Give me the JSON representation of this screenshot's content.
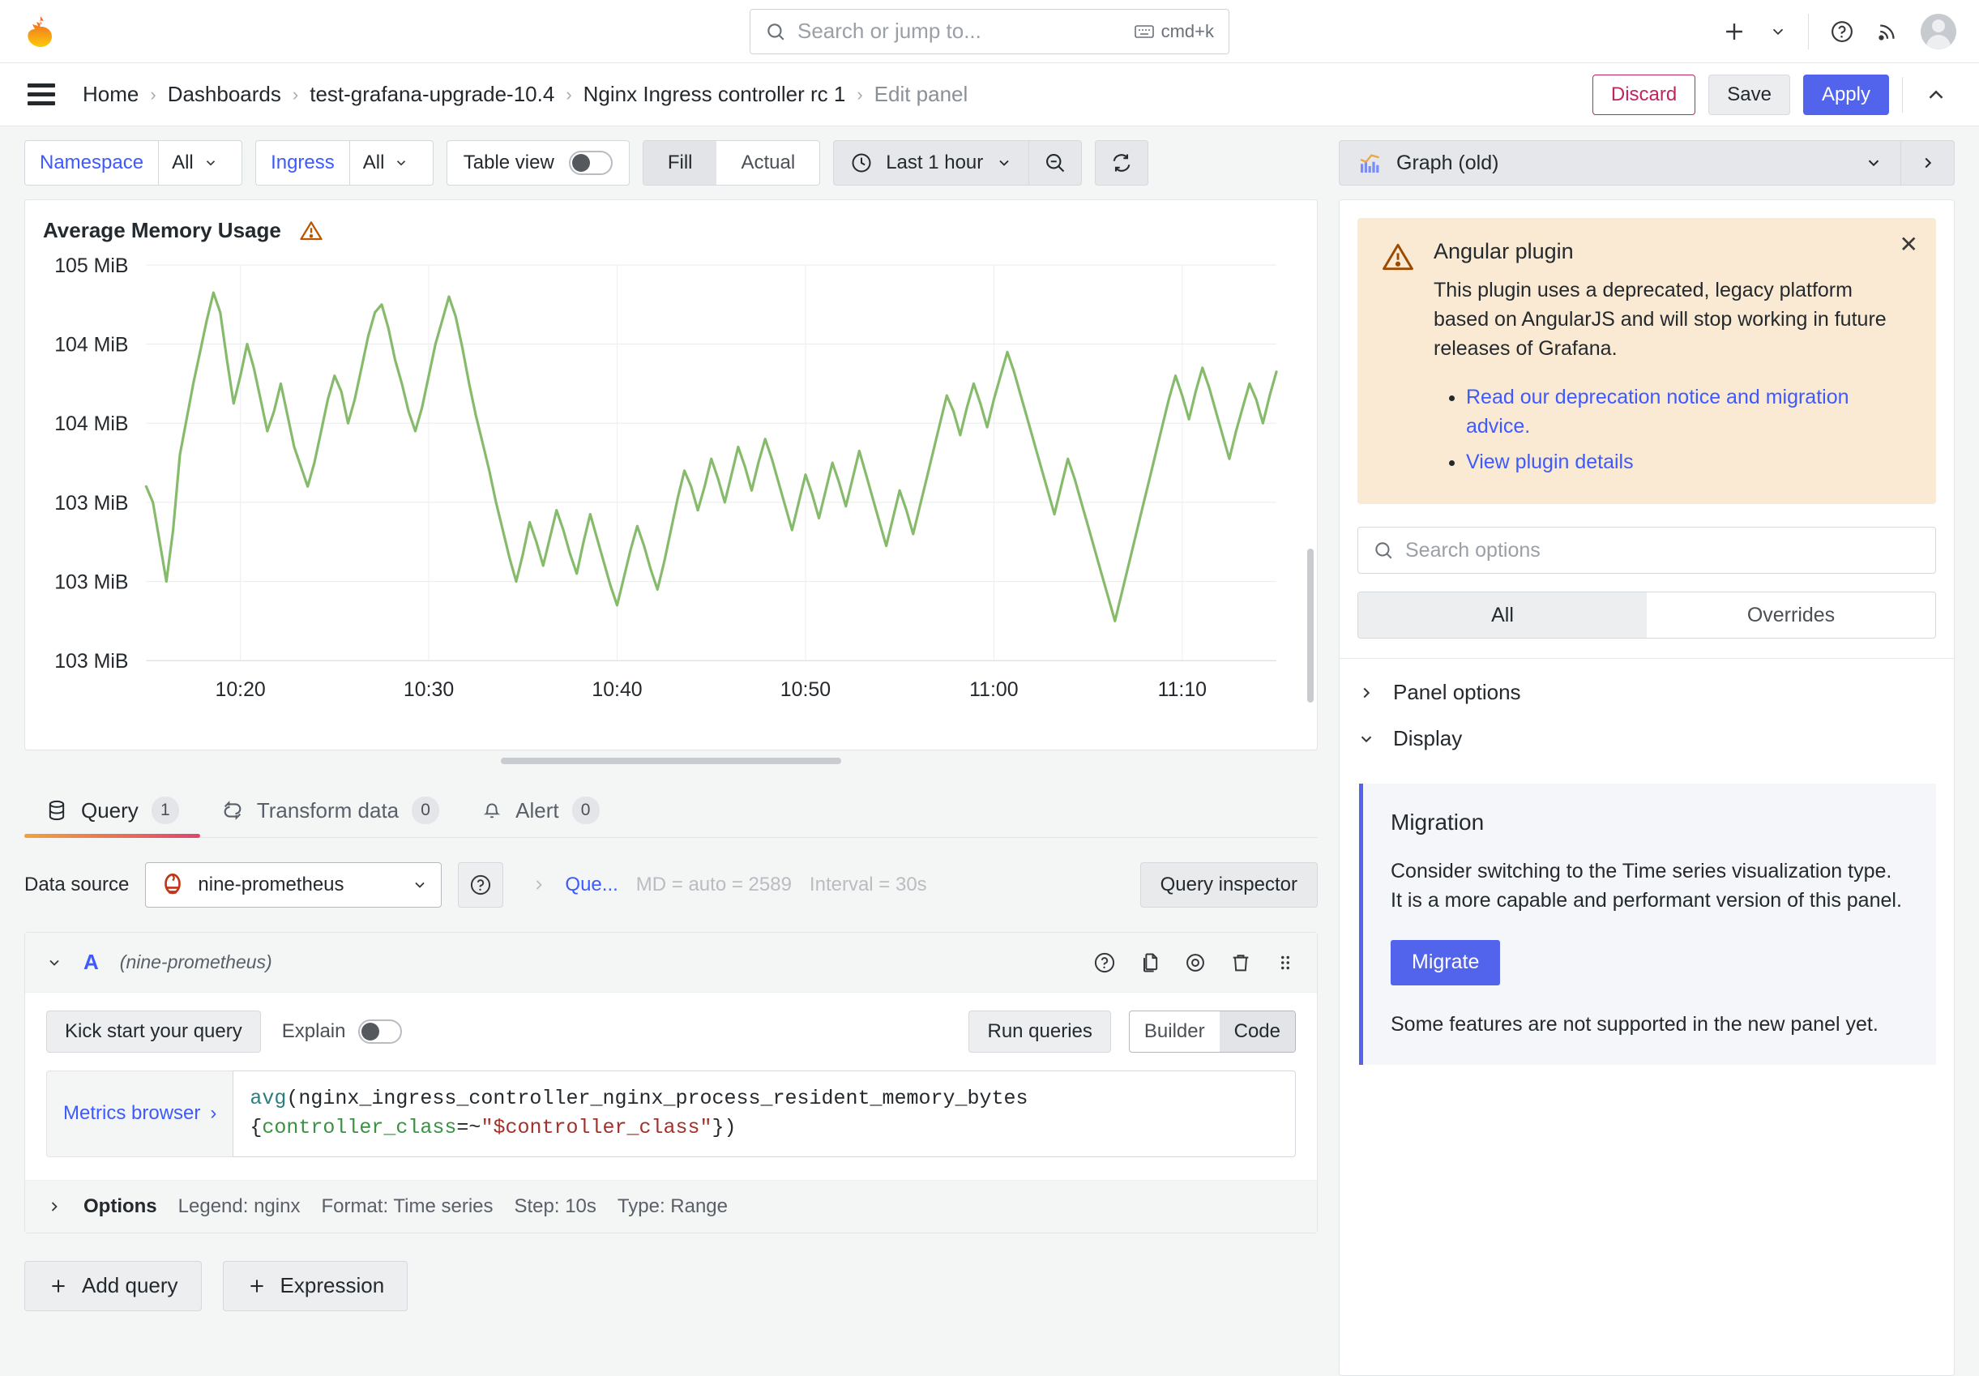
{
  "topbar": {
    "logo_icon": "grafana-logo-icon",
    "search_placeholder": "Search or jump to...",
    "kbd_shortcut": "cmd+k",
    "add_icon": "plus-icon",
    "add_chevron_icon": "chevron-down-icon",
    "help_icon": "help-circle-icon",
    "news_icon": "rss-icon",
    "avatar_icon": "user-avatar"
  },
  "breadcrumb": {
    "menu_icon": "hamburger-menu-icon",
    "items": [
      {
        "label": "Home",
        "current": false
      },
      {
        "label": "Dashboards",
        "current": false
      },
      {
        "label": "test-grafana-upgrade-10.4",
        "current": false
      },
      {
        "label": "Nginx Ingress controller rc 1",
        "current": false
      },
      {
        "label": "Edit panel",
        "current": true
      }
    ],
    "separator": "›",
    "discard_label": "Discard",
    "save_label": "Save",
    "apply_label": "Apply",
    "collapse_icon": "chevron-up-icon"
  },
  "subtoolbar": {
    "variables": [
      {
        "name": "Namespace",
        "value": "All"
      },
      {
        "name": "Ingress",
        "value": "All"
      }
    ],
    "table_view_label": "Table view",
    "table_view_on": false,
    "fill_actual": {
      "options": [
        "Fill",
        "Actual"
      ],
      "selected": "Fill"
    },
    "time_range": "Last 1 hour",
    "clock_icon": "clock-icon",
    "zoom_out_icon": "zoom-out-icon",
    "refresh_icon": "refresh-icon",
    "viz_picker": {
      "label": "Graph (old)",
      "icon": "graph-old-icon",
      "chevron": "chevron-down-icon",
      "expand": "chevron-right-icon"
    }
  },
  "panel": {
    "title": "Average Memory Usage",
    "warning_icon": "warning-triangle-icon"
  },
  "chart_data": {
    "type": "line",
    "title": "Average Memory Usage",
    "xlabel": "",
    "ylabel": "",
    "grid": true,
    "legend": "none",
    "series_color": "#86bb6b",
    "y_tick_labels": [
      "105 MiB",
      "104 MiB",
      "104 MiB",
      "103 MiB",
      "103 MiB",
      "103 MiB"
    ],
    "x_tick_labels": [
      "10:20",
      "10:30",
      "10:40",
      "10:50",
      "11:00",
      "11:10"
    ],
    "ylim": [
      0,
      100
    ],
    "series": [
      {
        "name": "nginx",
        "values": [
          44,
          40,
          30,
          20,
          33,
          52,
          61,
          70,
          78,
          86,
          93,
          88,
          76,
          65,
          72,
          80,
          74,
          66,
          58,
          63,
          70,
          62,
          54,
          49,
          44,
          50,
          58,
          66,
          72,
          68,
          60,
          66,
          74,
          82,
          88,
          90,
          84,
          76,
          70,
          63,
          58,
          64,
          72,
          80,
          86,
          92,
          87,
          79,
          70,
          62,
          55,
          48,
          40,
          33,
          26,
          20,
          27,
          35,
          30,
          24,
          31,
          38,
          33,
          27,
          22,
          30,
          37,
          31,
          25,
          19,
          14,
          21,
          28,
          34,
          29,
          23,
          18,
          25,
          33,
          41,
          48,
          44,
          38,
          44,
          51,
          46,
          40,
          47,
          54,
          49,
          43,
          50,
          56,
          51,
          45,
          39,
          33,
          40,
          47,
          42,
          36,
          43,
          50,
          45,
          39,
          46,
          53,
          47,
          41,
          35,
          29,
          36,
          43,
          38,
          32,
          39,
          46,
          53,
          60,
          67,
          63,
          57,
          64,
          70,
          65,
          59,
          66,
          72,
          78,
          73,
          67,
          61,
          55,
          49,
          43,
          37,
          44,
          51,
          46,
          40,
          34,
          28,
          22,
          16,
          10,
          17,
          24,
          31,
          38,
          45,
          52,
          59,
          66,
          72,
          67,
          61,
          68,
          74,
          69,
          63,
          57,
          51,
          58,
          64,
          70,
          66,
          60,
          67,
          73
        ]
      }
    ]
  },
  "tabs": [
    {
      "label": "Query",
      "count": "1",
      "icon": "database-icon",
      "active": true
    },
    {
      "label": "Transform data",
      "count": "0",
      "icon": "transform-icon",
      "active": false
    },
    {
      "label": "Alert",
      "count": "0",
      "icon": "bell-icon",
      "active": false
    }
  ],
  "query_editor": {
    "datasource_label": "Data source",
    "datasource_value": "nine-prometheus",
    "datasource_icon": "prometheus-icon",
    "help_icon": "help-circle-icon",
    "expand_icon": "chevron-right-icon",
    "query_options_label": "Que...",
    "max_data_points": "MD = auto = 2589",
    "interval": "Interval = 30s",
    "query_inspector_label": "Query inspector",
    "row": {
      "collapse_icon": "chevron-down-icon",
      "ref_id": "A",
      "datasource": "(nine-prometheus)",
      "icons": [
        "help-circle-icon",
        "duplicate-icon",
        "eye-icon",
        "trash-icon",
        "drag-handle-icon"
      ],
      "kick_start_label": "Kick start your query",
      "explain_label": "Explain",
      "explain_on": false,
      "run_queries_label": "Run queries",
      "builder_code": {
        "options": [
          "Builder",
          "Code"
        ],
        "selected": "Code"
      },
      "metrics_browser_label": "Metrics browser",
      "metrics_browser_chevron": "›",
      "code": {
        "fn": "avg",
        "open": "(",
        "metric": "nginx_ingress_controller_nginx_process_resident_memory_bytes",
        "brace_open": "{",
        "label": "controller_class",
        "op": "=~",
        "value": "\"$controller_class\"",
        "brace_close": "}",
        "close": ")"
      },
      "options_label": "Options",
      "options_meta": [
        "Legend: nginx",
        "Format: Time series",
        "Step: 10s",
        "Type: Range"
      ]
    },
    "add_query_label": "Add query",
    "add_expression_label": "Expression",
    "plus_icon": "plus-icon"
  },
  "options_pane": {
    "alert": {
      "icon": "warning-triangle-icon",
      "close_icon": "close-icon",
      "title": "Angular plugin",
      "body": "This plugin uses a deprecated, legacy platform based on AngularJS and will stop working in future releases of Grafana.",
      "links": [
        "Read our deprecation notice and migration advice.",
        "View plugin details"
      ]
    },
    "search_placeholder": "Search options",
    "search_icon": "search-icon",
    "tabs": {
      "options": [
        "All",
        "Overrides"
      ],
      "selected": "All"
    },
    "sections": [
      {
        "label": "Panel options",
        "expanded": false,
        "icon": "chevron-right-icon"
      },
      {
        "label": "Display",
        "expanded": true,
        "icon": "chevron-down-icon"
      }
    ],
    "migration": {
      "title": "Migration",
      "body": "Consider switching to the Time series visualization type. It is a more capable and performant version of this panel.",
      "button_label": "Migrate",
      "footer": "Some features are not supported in the new panel yet."
    }
  },
  "colors": {
    "accent_blue": "#5263ec",
    "link_blue": "#3d5afe",
    "discard_red": "#c0255f",
    "series_green": "#86bb6b",
    "warn_orange": "#b95700",
    "alert_bg": "#faead3"
  }
}
